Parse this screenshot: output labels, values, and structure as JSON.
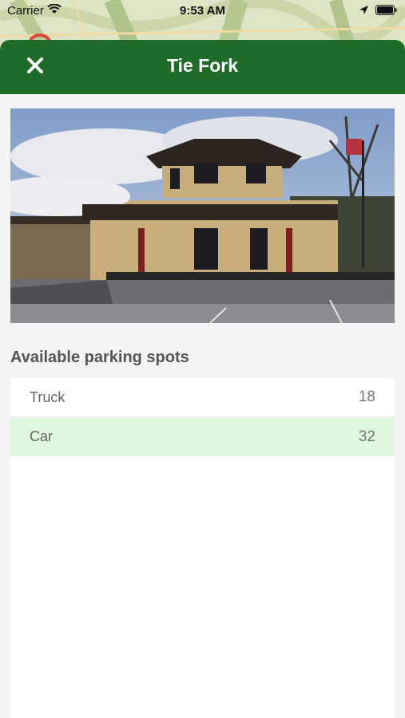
{
  "status_bar": {
    "carrier": "Carrier",
    "time": "9:53 AM"
  },
  "header": {
    "title": "Tie Fork",
    "close_icon": "close-icon",
    "background_color": "#1e6b2a"
  },
  "photo": {
    "description_icon": "station-photo"
  },
  "parking": {
    "section_title": "Available parking spots",
    "rows": [
      {
        "label": "Truck",
        "count": "18",
        "highlighted": false
      },
      {
        "label": "Car",
        "count": "32",
        "highlighted": true
      }
    ],
    "highlight_color": "#dff7dd"
  }
}
